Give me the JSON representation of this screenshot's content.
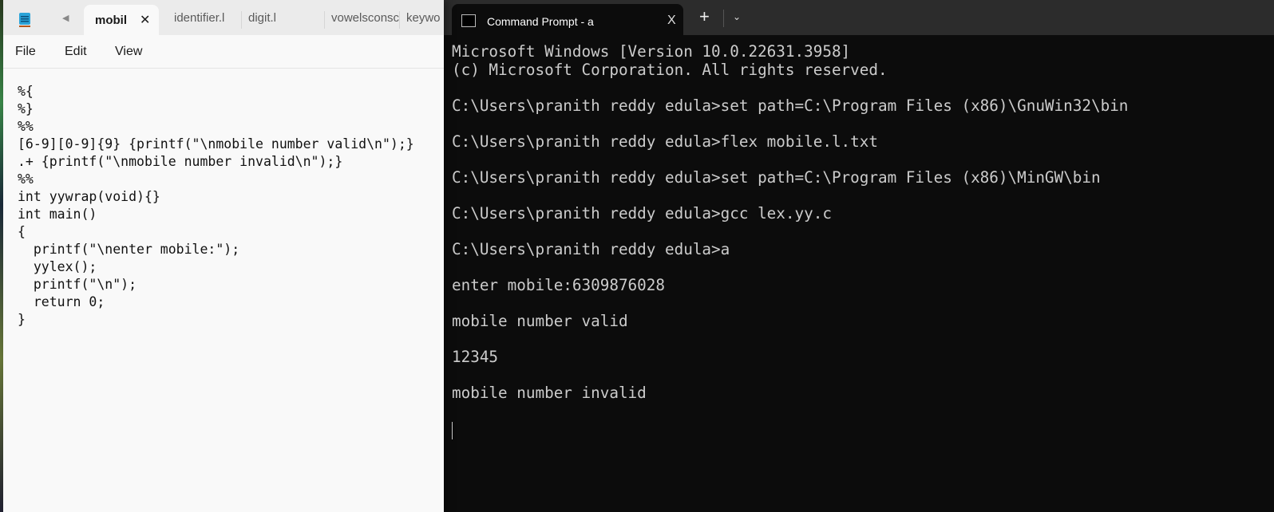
{
  "notepad": {
    "tabs": [
      {
        "label": "mobil",
        "active": true
      },
      {
        "label": "identifier.l"
      },
      {
        "label": "digit.l"
      },
      {
        "label": "vowelsconsc"
      },
      {
        "label": "keywo"
      }
    ],
    "close_glyph": "✕",
    "menu": [
      "File",
      "Edit",
      "View"
    ],
    "code": "%{\n%}\n%%\n[6-9][0-9]{9} {printf(\"\\nmobile number valid\\n\");}\n.+ {printf(\"\\nmobile number invalid\\n\");}\n%%\nint yywrap(void){}\nint main()\n{\n  printf(\"\\nenter mobile:\");\n  yylex();\n  printf(\"\\n\");\n  return 0;\n}"
  },
  "terminal": {
    "tab_title": "Command Prompt - a",
    "close_glyph": "X",
    "new_tab_glyph": "+",
    "dropdown_glyph": "⌄",
    "output": "Microsoft Windows [Version 10.0.22631.3958]\n(c) Microsoft Corporation. All rights reserved.\n\nC:\\Users\\pranith reddy edula>set path=C:\\Program Files (x86)\\GnuWin32\\bin\n\nC:\\Users\\pranith reddy edula>flex mobile.l.txt\n\nC:\\Users\\pranith reddy edula>set path=C:\\Program Files (x86)\\MinGW\\bin\n\nC:\\Users\\pranith reddy edula>gcc lex.yy.c\n\nC:\\Users\\pranith reddy edula>a\n\nenter mobile:6309876028\n\nmobile number valid\n\n12345\n\nmobile number invalid",
    "colors": {
      "background": "#0c0c0c",
      "text": "#cccccc"
    }
  }
}
